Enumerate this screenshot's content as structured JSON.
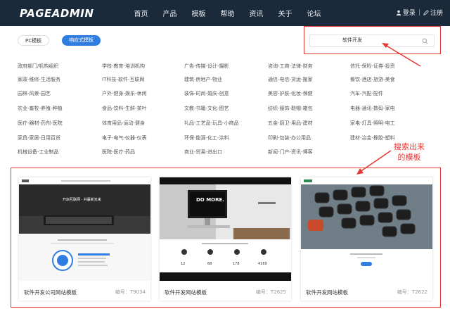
{
  "header": {
    "logo": "PAGEADMIN",
    "nav": [
      "首页",
      "产品",
      "模板",
      "帮助",
      "资讯",
      "关于",
      "论坛"
    ],
    "login": "登录",
    "register": "注册"
  },
  "filters": {
    "pc": "PC模板",
    "responsive": "响应式模板"
  },
  "search": {
    "value": "软件开发"
  },
  "categories": [
    [
      "政府部门/机构组织",
      "学校-教育-培训机构",
      "广告-传媒-设计-摄影",
      "咨询-工商-法律-财务",
      "信托-保险-证券-投资"
    ],
    [
      "家政-维修-生活服务",
      "IT科技-软件-互联网",
      "建筑-房地产-物业",
      "通信-电信-货运-搬家",
      "餐饮-酒店-旅游-美食"
    ],
    [
      "园林-风景-园艺",
      "户外-健身-娱乐-休闲",
      "装饰-时尚-婚庆-创意",
      "美容-护肤-化妆-保健",
      "汽车-汽配-配件"
    ],
    [
      "农业-畜牧-养殖-种植",
      "食品-饮料-生鲜-茶叶",
      "文教-书籍-文化-图艺",
      "纺织-服饰-鞋帽-箱包",
      "电器-通讯-数码-家电"
    ],
    [
      "医疗-器材-药剂-医院",
      "体育用品-运动-健身",
      "礼品-工艺品-玩具-小商品",
      "五金-厨卫-用品-建材",
      "家电-灯具-照明-电工"
    ],
    [
      "家具-家居-日用百货",
      "电子-电气-仪器-仪表",
      "环保-能源-化工-涂料",
      "印刷-包装-办公用品",
      "建材-冶金-橡胶-塑料"
    ],
    [
      "机械设备-工业制品",
      "医院-医疗-药品",
      "商业-贸易-进出口",
      "新闻-门户-资讯-博客",
      ""
    ]
  ],
  "annotation": {
    "line1": "搜索出来",
    "line2": "的模板"
  },
  "results": [
    {
      "name": "软件开发公司网站模板",
      "code": "编号：T9034",
      "banner_text": "开启互联网 · 共赢新未来"
    },
    {
      "name": "软件开发网站模板",
      "code": "编号：T2625",
      "banner_text": "DO MORE."
    },
    {
      "name": "软件开发网站模板",
      "code": "编号：T2622",
      "banner_text": ""
    }
  ],
  "stats_card2": [
    "12",
    "68",
    "178",
    "4169"
  ],
  "colors": {
    "topbar": "#1b2a3a",
    "accent": "#2f7de1",
    "annotation": "#e53935"
  },
  "icons": {
    "search": "search-icon",
    "user": "user-icon",
    "edit": "edit-icon"
  }
}
